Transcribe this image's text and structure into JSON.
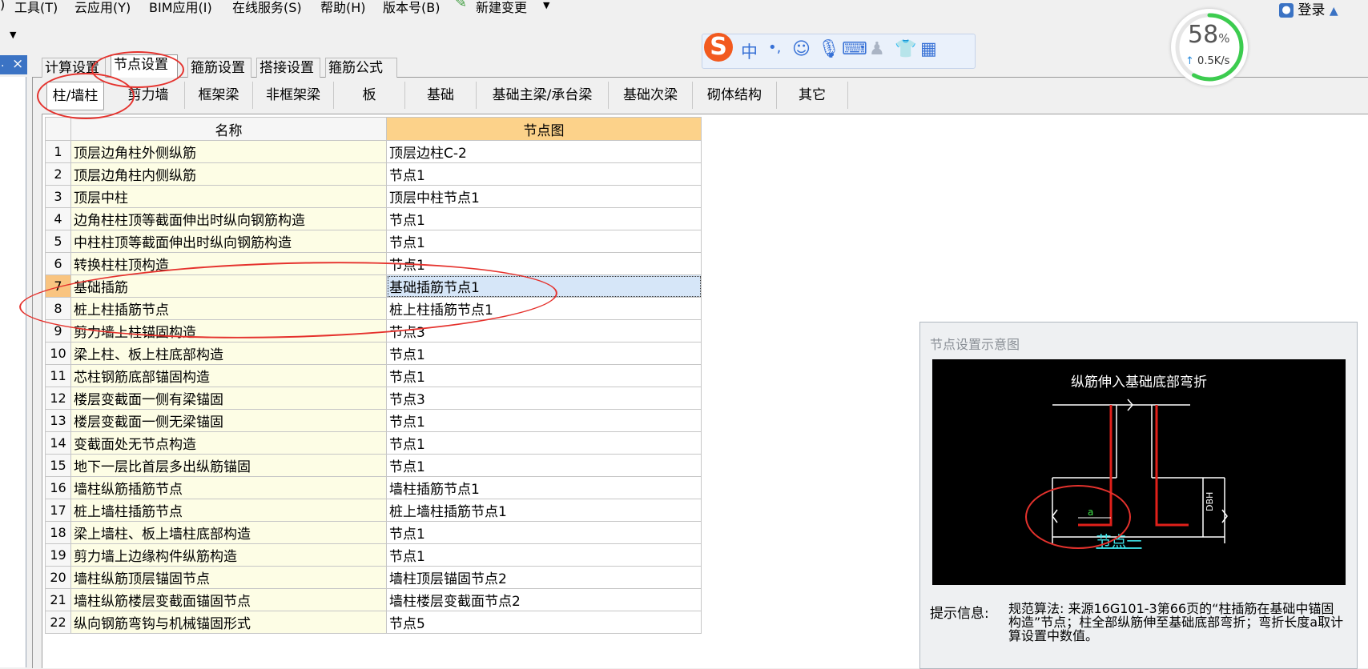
{
  "menubar": {
    "items": [
      "工具(T)",
      "云应用(Y)",
      "BIM应用(I)",
      "在线服务(S)",
      "帮助(H)",
      "版本号(B)",
      "新建变更"
    ],
    "leading": ")",
    "login": "登录"
  },
  "left_tab": {
    "close": "×"
  },
  "settings_tabs": [
    "计算设置",
    "节点设置",
    "箍筋设置",
    "搭接设置",
    "箍筋公式"
  ],
  "active_settings_tab": "节点设置",
  "category_tabs": [
    "柱/墙柱",
    "剪力墙",
    "框架梁",
    "非框架梁",
    "板",
    "基础",
    "基础主梁/承台梁",
    "基础次梁",
    "砌体结构",
    "其它"
  ],
  "active_category_tab": "柱/墙柱",
  "grid": {
    "headers": {
      "name": "名称",
      "node": "节点图"
    },
    "selected_row": 7,
    "rows": [
      {
        "num": "1",
        "name": "顶层边角柱外侧纵筋",
        "node": "顶层边柱C-2"
      },
      {
        "num": "2",
        "name": "顶层边角柱内侧纵筋",
        "node": "节点1"
      },
      {
        "num": "3",
        "name": "顶层中柱",
        "node": "顶层中柱节点1"
      },
      {
        "num": "4",
        "name": "边角柱柱顶等截面伸出时纵向钢筋构造",
        "node": "节点1"
      },
      {
        "num": "5",
        "name": "中柱柱顶等截面伸出时纵向钢筋构造",
        "node": "节点1"
      },
      {
        "num": "6",
        "name": "转换柱柱顶构造",
        "node": "节点1"
      },
      {
        "num": "7",
        "name": "基础插筋",
        "node": "基础插筋节点1"
      },
      {
        "num": "8",
        "name": "桩上柱插筋节点",
        "node": "桩上柱插筋节点1"
      },
      {
        "num": "9",
        "name": "剪力墙上柱锚固构造",
        "node": "节点3"
      },
      {
        "num": "10",
        "name": "梁上柱、板上柱底部构造",
        "node": "节点1"
      },
      {
        "num": "11",
        "name": "芯柱钢筋底部锚固构造",
        "node": "节点1"
      },
      {
        "num": "12",
        "name": "楼层变截面一侧有梁锚固",
        "node": "节点3"
      },
      {
        "num": "13",
        "name": "楼层变截面一侧无梁锚固",
        "node": "节点1"
      },
      {
        "num": "14",
        "name": "变截面处无节点构造",
        "node": "节点1"
      },
      {
        "num": "15",
        "name": "地下一层比首层多出纵筋锚固",
        "node": "节点1"
      },
      {
        "num": "16",
        "name": "墙柱纵筋插筋节点",
        "node": "墙柱插筋节点1"
      },
      {
        "num": "17",
        "name": "桩上墙柱插筋节点",
        "node": "桩上墙柱插筋节点1"
      },
      {
        "num": "18",
        "name": "梁上墙柱、板上墙柱底部构造",
        "node": "节点1"
      },
      {
        "num": "19",
        "name": "剪力墙上边缘构件纵筋构造",
        "node": "节点1"
      },
      {
        "num": "20",
        "name": "墙柱纵筋顶层锚固节点",
        "node": "墙柱顶层锚固节点2"
      },
      {
        "num": "21",
        "name": "墙柱纵筋楼层变截面锚固节点",
        "node": "墙柱楼层变截面节点2"
      },
      {
        "num": "22",
        "name": "纵向钢筋弯钩与机械锚固形式",
        "node": "节点5"
      }
    ]
  },
  "preview": {
    "title": "节点设置示意图",
    "diagram_title": "纵筋伸入基础底部弯折",
    "dim_label": "DBH",
    "bend_label": "a",
    "node_link": "节点一",
    "hint_label": "提示信息:",
    "hint_text": "规范算法: 来源16G101-3第66页的“柱插筋在基础中锚固构造”节点；柱全部纵筋伸至基础底部弯折；弯折长度a取计算设置中数值。"
  },
  "ime": {
    "mode": "中",
    "punct": "•,",
    "icons": [
      "emoji-icon",
      "mic-icon",
      "keyboard-icon",
      "user-icon",
      "shirt-icon",
      "apps-icon"
    ]
  },
  "network": {
    "percent": "58",
    "unit": "%",
    "speed": "0.5K/s",
    "usage_fraction": 0.58
  },
  "colors": {
    "accent": "#3b73c4",
    "annotation": "#e5322d",
    "selected_row": "#f9c480",
    "header_node": "#fcd28a"
  }
}
